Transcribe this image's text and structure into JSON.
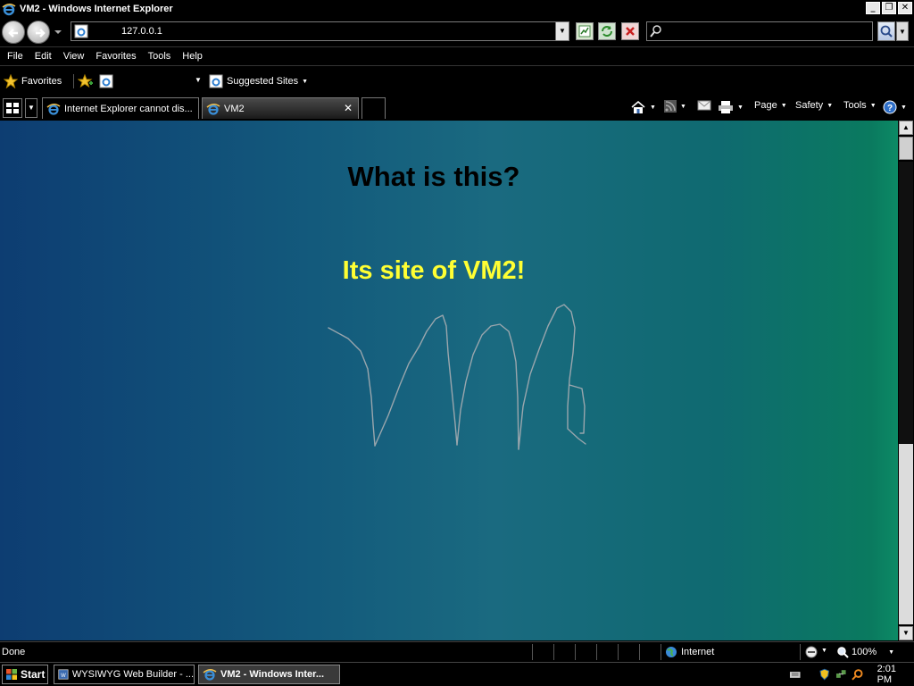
{
  "window": {
    "title": "VM2 - Windows Internet Explorer",
    "controls": [
      "_",
      "❐",
      "✕"
    ]
  },
  "address_bar": {
    "url": "127.0.0.1"
  },
  "menu": [
    "File",
    "Edit",
    "View",
    "Favorites",
    "Tools",
    "Help"
  ],
  "favorites_bar": {
    "favorites_label": "Favorites",
    "suggested_sites": "Suggested Sites"
  },
  "tabs": [
    {
      "label": "Internet Explorer cannot dis...",
      "active": false
    },
    {
      "label": "VM2",
      "active": true
    }
  ],
  "command_bar": {
    "page": "Page",
    "safety": "Safety",
    "tools": "Tools"
  },
  "page": {
    "heading": "What is this?",
    "subheading": "Its site of VM2!",
    "heading_color": "#000000",
    "subheading_color": "#ffff33",
    "background_gradient": [
      "#0d3d72",
      "#1a6a80",
      "#0c8a65"
    ]
  },
  "status_bar": {
    "text": "Done",
    "zone": "Internet",
    "zoom": "100%"
  },
  "taskbar": {
    "start": "Start",
    "tasks": [
      {
        "label": "WYSIWYG Web Builder - ...",
        "active": false
      },
      {
        "label": "VM2 - Windows Inter...",
        "active": true
      }
    ],
    "clock": "2:01 PM"
  }
}
